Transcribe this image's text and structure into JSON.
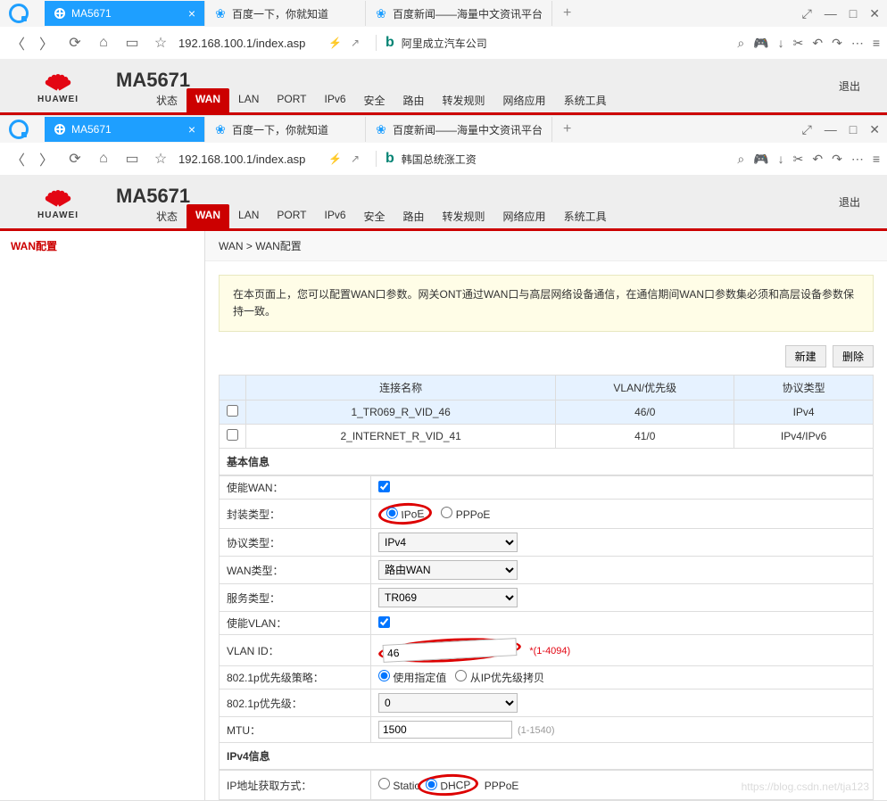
{
  "browser": {
    "tabs": [
      {
        "title": "MA5671"
      },
      {
        "title": "百度一下，你就知道"
      },
      {
        "title": "百度新闻——海量中文资讯平台"
      }
    ],
    "url": "192.168.100.1/index.asp"
  },
  "search1": "阿里成立汽车公司",
  "search2": "韩国总统涨工资",
  "router": {
    "brand": "HUAWEI",
    "title": "MA5671",
    "logout": "退出",
    "nav": [
      "状态",
      "WAN",
      "LAN",
      "PORT",
      "IPv6",
      "安全",
      "路由",
      "转发规则",
      "网络应用",
      "系统工具"
    ],
    "nav_active": 1
  },
  "sidebar": {
    "item": "WAN配置"
  },
  "breadcrumb": "WAN > WAN配置",
  "info": "在本页面上，您可以配置WAN口参数。网关ONT通过WAN口与高层网络设备通信，在通信期间WAN口参数集必须和高层设备参数保持一致。",
  "buttons": {
    "new": "新建",
    "delete": "删除"
  },
  "table": {
    "headers": [
      "连接名称",
      "VLAN/优先级",
      "协议类型"
    ],
    "rows": [
      {
        "name": "1_TR069_R_VID_46",
        "vlan": "46/0",
        "proto": "IPv4"
      },
      {
        "name": "2_INTERNET_R_VID_41",
        "vlan": "41/0",
        "proto": "IPv4/IPv6"
      }
    ]
  },
  "sections": {
    "basic": "基本信息",
    "ipv4": "IPv4信息"
  },
  "form": {
    "enable_wan": {
      "label": "使能WAN："
    },
    "encap": {
      "label": "封装类型：",
      "opt1": "IPoE",
      "opt2": "PPPoE"
    },
    "proto": {
      "label": "协议类型：",
      "value": "IPv4"
    },
    "wan_type": {
      "label": "WAN类型：",
      "value": "路由WAN"
    },
    "service": {
      "label": "服务类型：",
      "value": "TR069"
    },
    "enable_vlan": {
      "label": "使能VLAN："
    },
    "vlan_id": {
      "label": "VLAN ID：",
      "value": "46",
      "hint": "*(1-4094)"
    },
    "p8021_policy": {
      "label": "802.1p优先级策略：",
      "opt1": "使用指定值",
      "opt2": "从IP优先级拷贝"
    },
    "p8021": {
      "label": "802.1p优先级：",
      "value": "0"
    },
    "mtu": {
      "label": "MTU：",
      "value": "1500",
      "hint": "(1-1540)"
    },
    "ip_mode": {
      "label": "IP地址获取方式：",
      "opt1": "Static",
      "opt2": "DHCP",
      "opt3": "PPPoE"
    }
  },
  "watermark": "https://blog.csdn.net/tja123"
}
